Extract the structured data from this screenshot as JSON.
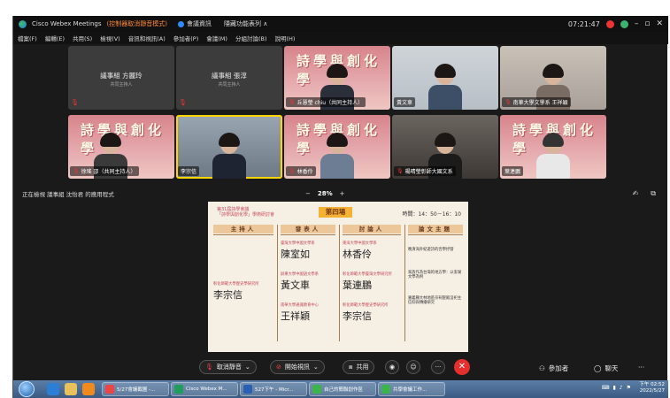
{
  "titlebar": {
    "app_name": "Cisco Webex Meetings",
    "status": "(控制器取消靜音模式)",
    "meeting_info": "會議資訊",
    "hide_menu": "隱藏功能表列 ∧",
    "clock": "07:21:47"
  },
  "menu": [
    "檔案(F)",
    "編輯(E)",
    "共用(S)",
    "檢視(V)",
    "音訊和視訊(A)",
    "參加者(P)",
    "會議(M)",
    "分組討論(B)",
    "說明(H)"
  ],
  "participants": [
    {
      "name": "議事組 方麗玲",
      "role": "共同主持人"
    },
    {
      "name": "議事組 張淳",
      "role": "共同主持人"
    },
    {
      "name": "丘慧瑩 chiu（共同主持人）"
    },
    {
      "name": "黃文車"
    },
    {
      "name": "南華大學文學系 王祥穎"
    },
    {
      "name": "徐瑤 卲（共同主持人）"
    },
    {
      "name": "李宗信"
    },
    {
      "name": "林香伶"
    },
    {
      "name": "楊晴瑩彰師大國文系"
    },
    {
      "name": "葉連鵬"
    }
  ],
  "poster_text": "詩學與創化學",
  "viewbar": {
    "viewing": "正在檢視 議事組 沈怡君 的應用程式",
    "zoom_out": "−",
    "zoom": "28%",
    "zoom_in": "+"
  },
  "slide": {
    "header_line1": "第31屆詩學會議",
    "header_line2": "「詩學與創化學」學術研討會",
    "round": "第四場",
    "time": "時間：14：50－16：10",
    "columns": [
      {
        "head": "主持人",
        "entries": [
          {
            "aff": "彰化師範大學歷史學研究所",
            "name": "李宗信"
          }
        ]
      },
      {
        "head": "發表人",
        "entries": [
          {
            "aff": "臺灣大學中國文學系",
            "name": "陳室如"
          },
          {
            "aff": "屏東大學中國語文學系",
            "name": "黃文車"
          },
          {
            "aff": "南華大學通識教育中心",
            "name": "王祥穎"
          }
        ]
      },
      {
        "head": "討論人",
        "entries": [
          {
            "aff": "東海大學中國文學系",
            "name": "林香伶"
          },
          {
            "aff": "彰化師範大學臺灣文學研究所",
            "name": "葉連鵬"
          },
          {
            "aff": "彰化師範大學歷史學研究所",
            "name": "李宗信"
          }
        ]
      },
      {
        "head": "論文主題",
        "topics": [
          "晚清海外紀遊詩的否學抒發",
          "家族作為台灣的地方學：以澎湖文學為例",
          "嘉義縣大林地區宗祠聖殿沒祀主信仰與傳播研究"
        ]
      }
    ]
  },
  "toolbar": {
    "unmute": "取消靜音",
    "start_video": "開始視訊",
    "share": "共用",
    "participants": "參加者",
    "chat": "聊天"
  },
  "taskbar": {
    "items": [
      "5/27會議截圖 -...",
      "Cisco Webex M...",
      "527下午 - Micr...",
      "自己的簡聯創作區",
      "共學會議工作..."
    ],
    "time": "下午 02:52",
    "date": "2022/5/27"
  },
  "colors": {
    "end_call": "#e52e2e",
    "accent_round": "#f3b135",
    "slide_red": "#c34858"
  }
}
